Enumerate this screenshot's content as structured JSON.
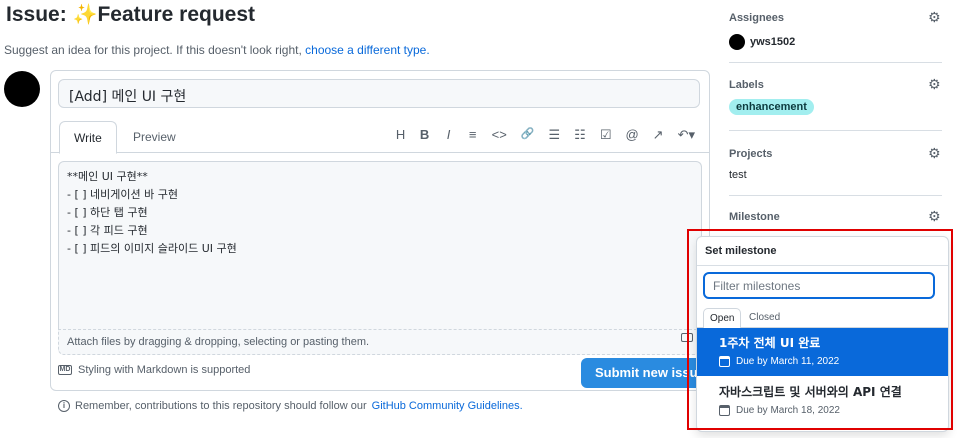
{
  "issue": {
    "title_prefix": "Issue:",
    "title_emoji": "✨",
    "title_type": "Feature request",
    "subtitle": "Suggest an idea for this project. If this doesn't look right,",
    "subtitle_link": "choose a different type."
  },
  "editor": {
    "title_value": "[Add] 메인 UI 구현",
    "tabs": [
      "Write",
      "Preview"
    ],
    "toolbar_icons": [
      "H",
      "B",
      "I",
      "≡",
      "<>",
      "🔗",
      "☰",
      "☷",
      "☑",
      "@",
      "↗",
      "↶▾"
    ],
    "body_lines": [
      "**메인 UI 구현**",
      "- [ ] 네비게이션 바 구현",
      "- [ ] 하단 탭 구현",
      "- [ ] 각 피드 구현",
      "- [ ] 피드의 이미지 슬라이드 UI 구현"
    ],
    "attach_hint": "Attach files by dragging & dropping, selecting or pasting them.",
    "markdown_note": "Styling with Markdown is supported",
    "markdown_icon_text": "MD",
    "submit_label": "Submit new issue"
  },
  "notice": {
    "text": "Remember, contributions to this repository should follow our",
    "link": "GitHub Community Guidelines."
  },
  "sidebar": {
    "assignees_label": "Assignees",
    "assignee_name": "yws1502",
    "labels_label": "Labels",
    "label_name": "enhancement",
    "label_color": "#a2eeef",
    "projects_label": "Projects",
    "project_name": "test",
    "milestone_label": "Milestone"
  },
  "milestone_popup": {
    "title": "Set milestone",
    "filter_placeholder": "Filter milestones",
    "tabs": [
      "Open",
      "Closed"
    ],
    "items": [
      {
        "name": "1주차 전체 UI 완료",
        "due": "Due by March 11, 2022",
        "selected": true
      },
      {
        "name": "자바스크립트 및 서버와의 API 연결",
        "due": "Due by March 18, 2022",
        "selected": false
      }
    ]
  },
  "colors": {
    "accent": "#0969da",
    "highlight_box": "#e00000"
  }
}
